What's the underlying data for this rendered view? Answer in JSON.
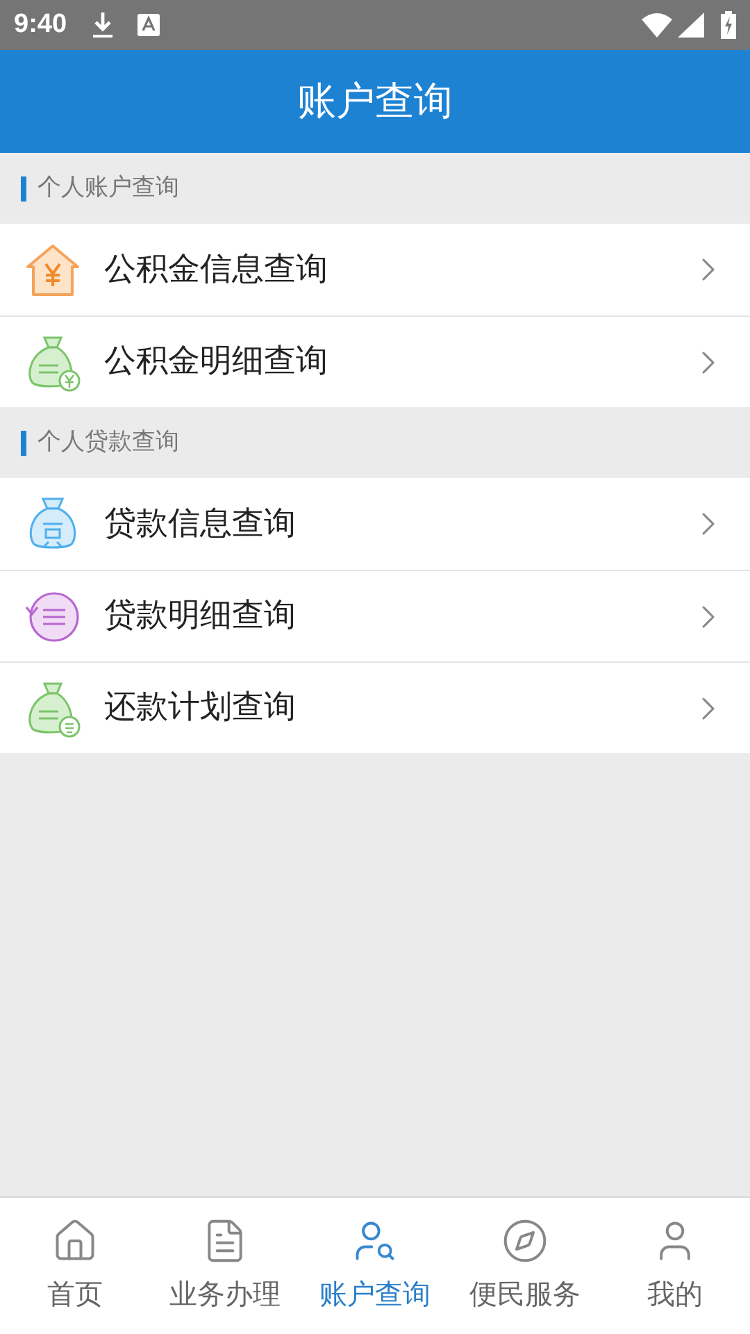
{
  "status_bar": {
    "time": "9:40"
  },
  "header": {
    "title": "账户查询"
  },
  "sections": [
    {
      "title": "个人账户查询",
      "items": [
        {
          "label": "公积金信息查询",
          "kind": "house"
        },
        {
          "label": "公积金明细查询",
          "kind": "coin-bag"
        }
      ]
    },
    {
      "title": "个人贷款查询",
      "items": [
        {
          "label": "贷款信息查询",
          "kind": "loan-bag"
        },
        {
          "label": "贷款明细查询",
          "kind": "cycle"
        },
        {
          "label": "还款计划查询",
          "kind": "badge-bag"
        }
      ]
    }
  ],
  "tabs": [
    {
      "label": "首页",
      "kind": "home",
      "selected": false
    },
    {
      "label": "业务办理",
      "kind": "doc",
      "selected": false
    },
    {
      "label": "账户查询",
      "kind": "search-user",
      "selected": true
    },
    {
      "label": "便民服务",
      "kind": "compass",
      "selected": false
    },
    {
      "label": "我的",
      "kind": "user",
      "selected": false
    }
  ]
}
